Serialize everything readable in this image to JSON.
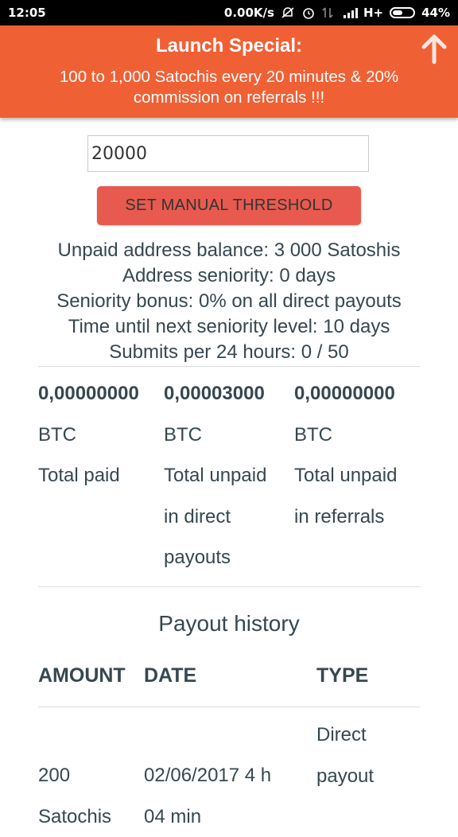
{
  "status_bar": {
    "time": "12:05",
    "net_speed": "0.00K/s",
    "network": "H+",
    "battery": "44%",
    "icons": [
      "mute-icon",
      "alarm-icon",
      "data-arrows-icon",
      "signal-icon",
      "battery-icon"
    ]
  },
  "banner": {
    "title": "Launch Special:",
    "message_line1": "100 to 1,000 Satochis every 20 minutes & 20%",
    "message_line2": "commission on referrals !!!",
    "background": "#f06035"
  },
  "threshold": {
    "value": "20000",
    "button_label": "SET MANUAL THRESHOLD",
    "button_color": "#e85a4f"
  },
  "info_lines": [
    "Unpaid address balance: 3 000 Satoshis",
    "Address seniority: 0 days",
    "Seniority bonus: 0% on all direct payouts",
    "Time until next seniority level: 10 days",
    "Submits per 24 hours: 0 / 50"
  ],
  "stats": [
    {
      "amount": "0,00000000",
      "unit": "BTC",
      "label_lines": [
        "Total paid"
      ]
    },
    {
      "amount": "0,00003000",
      "unit": "BTC",
      "label_lines": [
        "Total unpaid",
        "in direct",
        "payouts"
      ]
    },
    {
      "amount": "0,00000000",
      "unit": "BTC",
      "label_lines": [
        "Total unpaid",
        "in referrals"
      ]
    }
  ],
  "payout_history": {
    "title": "Payout history",
    "columns": [
      "AMOUNT",
      "DATE",
      "TYPE"
    ],
    "rows": [
      {
        "amount_lines": [
          "200",
          "Satochis"
        ],
        "date_lines": [
          "02/06/2017 4 h",
          "04 min"
        ],
        "type_lines": [
          "Direct",
          "payout"
        ]
      }
    ]
  }
}
